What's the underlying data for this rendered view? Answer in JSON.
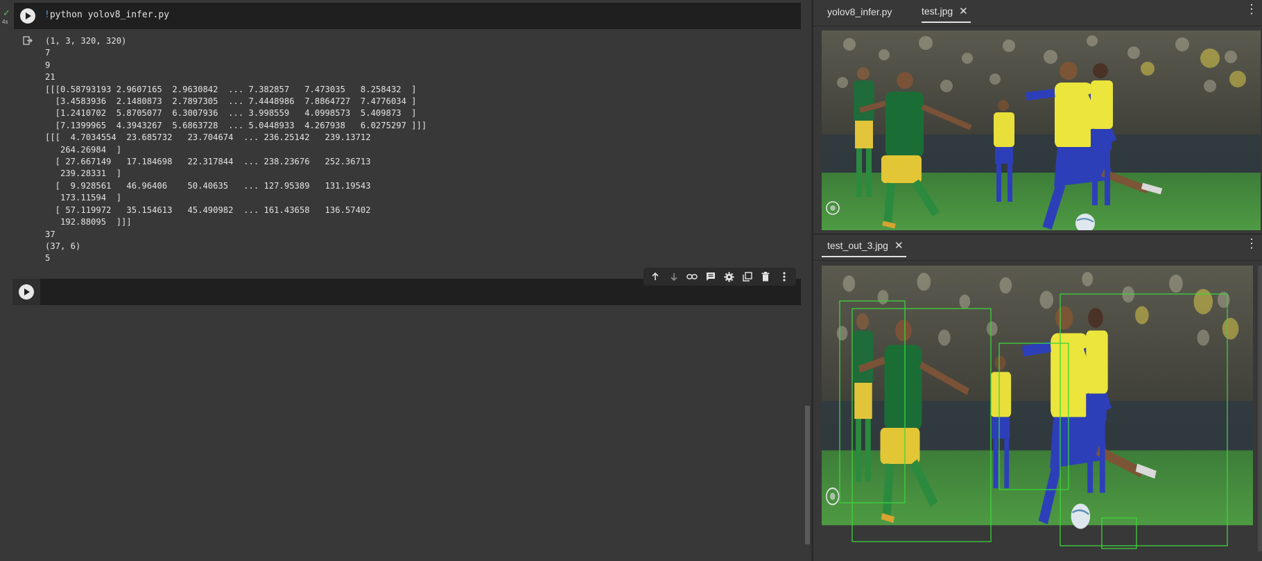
{
  "notebook": {
    "cell1": {
      "status_check": "✓",
      "exec_time": "4s",
      "code_bang": "!",
      "code_text": "python yolov8_infer.py",
      "output_lines": [
        "(1, 3, 320, 320)",
        "7",
        "9",
        "21",
        "[[[0.58793193 2.9607165  2.9630842  ... 7.382857   7.473035   8.258432  ]",
        "  [3.4583936  2.1480873  2.7897305  ... 7.4448986  7.8864727  7.4776034 ]",
        "  [1.2410702  5.8705077  6.3007936  ... 3.998559   4.0998573  5.409873  ]",
        "  [7.1399965  4.3943267  5.6863728  ... 5.0448933  4.267938   6.0275297 ]]]",
        "[[[  4.7034554  23.685732   23.704674  ... 236.25142   239.13712",
        "   264.26984  ]",
        "  [ 27.667149   17.184698   22.317844  ... 238.23676   252.36713",
        "   239.28331  ]",
        "  [  9.928561   46.96406    50.40635   ... 127.95389   131.19543",
        "   173.11594  ]",
        "  [ 57.119972   35.154613   45.490982  ... 161.43658   136.57402",
        "   192.88095  ]]]",
        "37",
        "(37, 6)",
        "5"
      ]
    },
    "toolbar": {
      "icons": [
        "arrow-up",
        "arrow-down",
        "link",
        "comment",
        "gear",
        "mirror-cell",
        "trash",
        "more-vert"
      ]
    }
  },
  "panes": {
    "top": {
      "tabs": [
        {
          "label": "yolov8_infer.py",
          "active": false
        },
        {
          "label": "test.jpg",
          "active": true,
          "closable": true
        }
      ],
      "close_glyph": "✕",
      "more_glyph": "⋮"
    },
    "bottom": {
      "tabs": [
        {
          "label": "test_out_3.jpg",
          "active": true,
          "closable": true
        }
      ],
      "close_glyph": "✕",
      "more_glyph": "⋮"
    }
  },
  "colors": {
    "background": "#383838",
    "cell": "#1f1f1f",
    "detection_box": "#3cd43c",
    "pitch": "#3e8f3a"
  }
}
